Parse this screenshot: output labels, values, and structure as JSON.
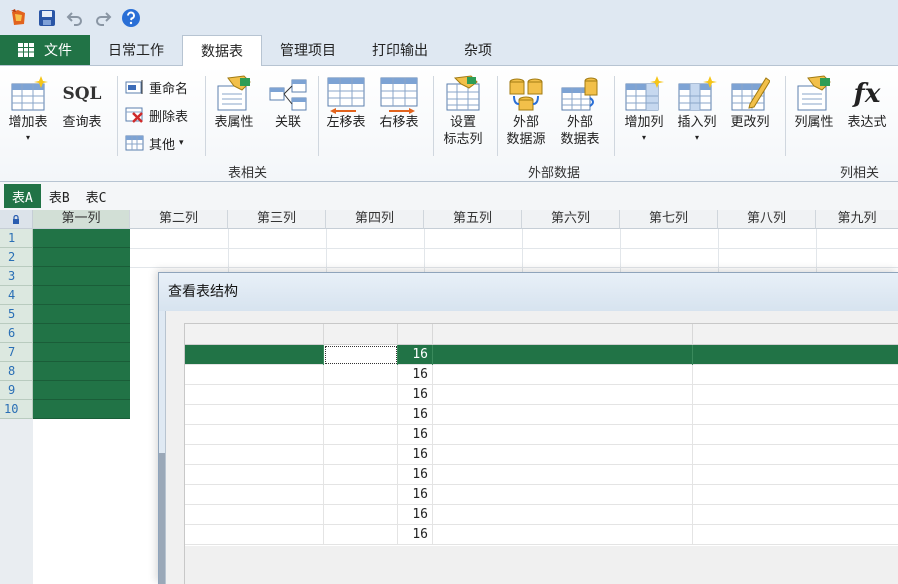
{
  "tabs": {
    "file": "文件",
    "items": [
      "日常工作",
      "数据表",
      "管理项目",
      "打印输出",
      "杂项"
    ],
    "active_index": 1
  },
  "ribbon": {
    "add_table": "增加表",
    "query_table": "查询表",
    "sql_icon_text": "SQL",
    "rename": "重命名",
    "delete_table": "删除表",
    "other": "其他",
    "table_properties": "表属性",
    "relation": "关联",
    "move_left": "左移表",
    "move_right": "右移表",
    "set_flag_col_1": "设置",
    "set_flag_col_2": "标志列",
    "group_table": "表相关",
    "ext_source_1": "外部",
    "ext_source_2": "数据源",
    "ext_table_1": "外部",
    "ext_table_2": "数据表",
    "group_external": "外部数据",
    "add_column": "增加列",
    "insert_column": "插入列",
    "change_column": "更改列",
    "column_properties": "列属性",
    "expression": "表达式",
    "fx_icon_text": "fx",
    "group_column": "列相关",
    "dropdown_arrow": "▾"
  },
  "sheet_tabs": [
    "表A",
    "表B",
    "表C"
  ],
  "grid": {
    "corner_icon": "lock-icon",
    "columns": [
      "第一列",
      "第二列",
      "第三列",
      "第四列",
      "第五列",
      "第六列",
      "第七列",
      "第八列",
      "第九列"
    ],
    "rows": [
      "1",
      "2",
      "3",
      "4",
      "5",
      "6",
      "7",
      "8",
      "9",
      "10"
    ]
  },
  "dialog": {
    "title": "查看表结构",
    "header": [
      "",
      "",
      "",
      "",
      ""
    ],
    "rows": [
      {
        "c1": "",
        "c2": "",
        "c3": "16",
        "c4": "",
        "c5": ""
      },
      {
        "c1": "",
        "c2": "",
        "c3": "16",
        "c4": "",
        "c5": ""
      },
      {
        "c1": "",
        "c2": "",
        "c3": "16",
        "c4": "",
        "c5": ""
      },
      {
        "c1": "",
        "c2": "",
        "c3": "16",
        "c4": "",
        "c5": ""
      },
      {
        "c1": "",
        "c2": "",
        "c3": "16",
        "c4": "",
        "c5": ""
      },
      {
        "c1": "",
        "c2": "",
        "c3": "16",
        "c4": "",
        "c5": ""
      },
      {
        "c1": "",
        "c2": "",
        "c3": "16",
        "c4": "",
        "c5": ""
      },
      {
        "c1": "",
        "c2": "",
        "c3": "16",
        "c4": "",
        "c5": ""
      },
      {
        "c1": "",
        "c2": "",
        "c3": "16",
        "c4": "",
        "c5": ""
      },
      {
        "c1": "",
        "c2": "",
        "c3": "16",
        "c4": "",
        "c5": ""
      }
    ]
  },
  "colors": {
    "accent_green": "#217346",
    "ribbon_bg": "#dfe8f2"
  }
}
